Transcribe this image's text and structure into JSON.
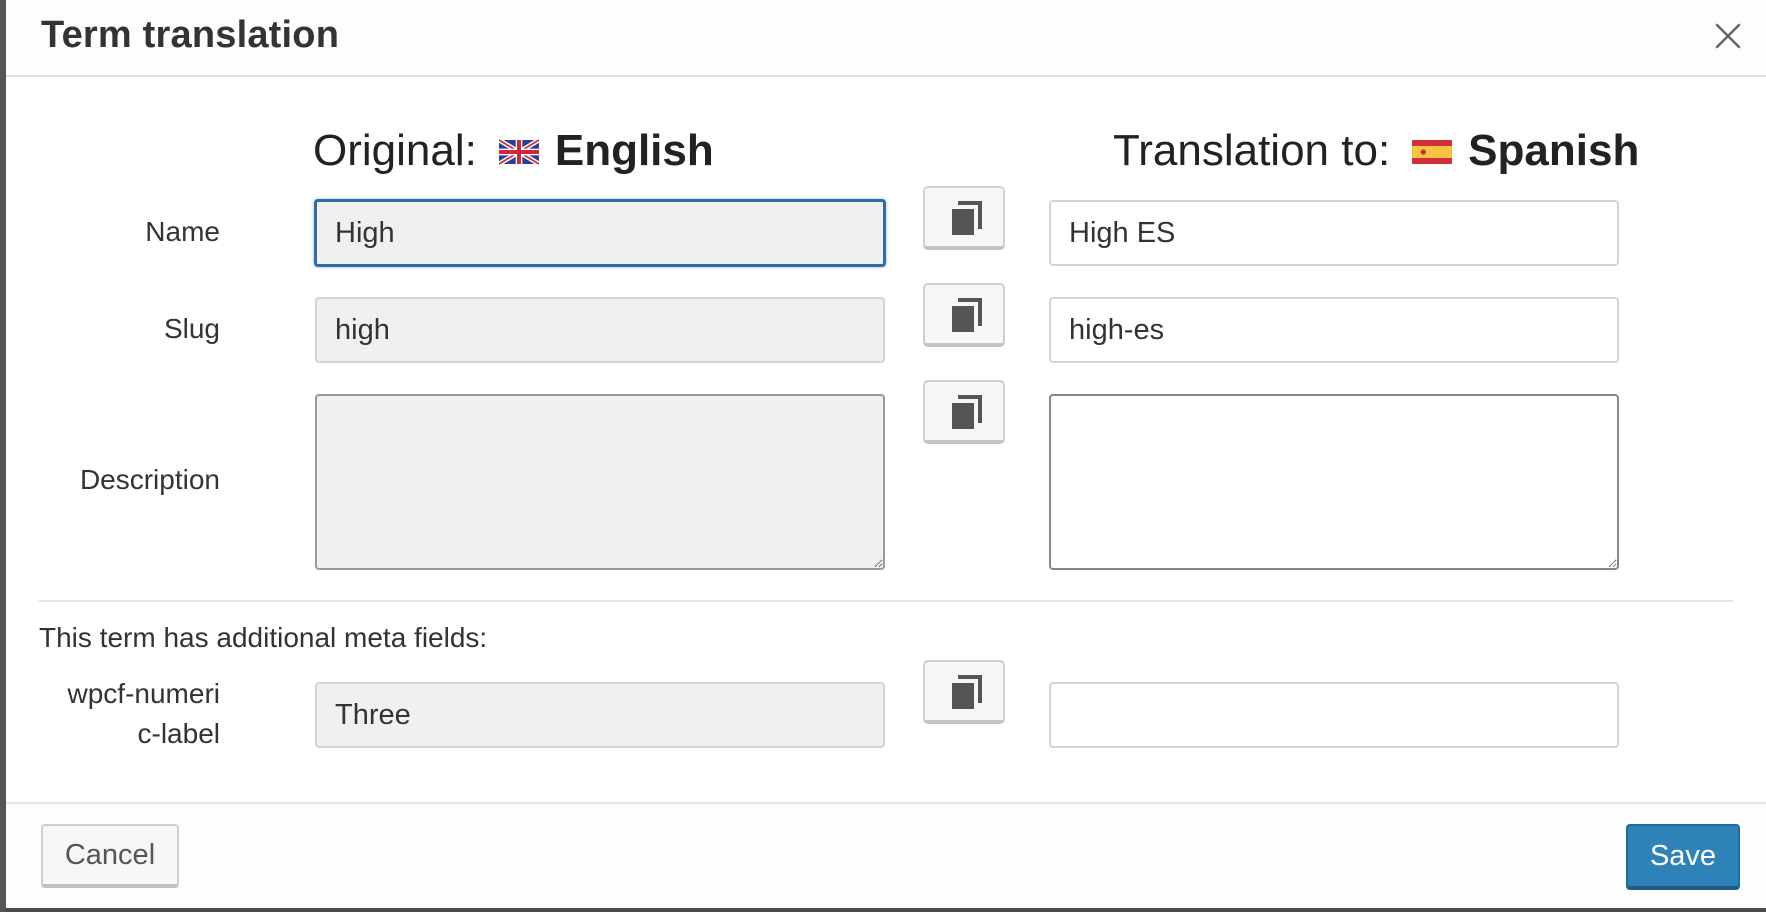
{
  "dialog": {
    "title": "Term translation",
    "close_icon": "close-icon"
  },
  "original": {
    "prefix": "Original:",
    "language": "English",
    "flag_icon": "uk-flag-icon"
  },
  "translation": {
    "prefix": "Translation to:",
    "language": "Spanish",
    "flag_icon": "spain-flag-icon"
  },
  "fields": {
    "name": {
      "label": "Name",
      "original": "High",
      "translated": "High ES"
    },
    "slug": {
      "label": "Slug",
      "original": "high",
      "translated": "high-es"
    },
    "description": {
      "label": "Description",
      "original": "",
      "translated": ""
    }
  },
  "meta": {
    "note": "This term has additional meta fields:",
    "field": {
      "label_line1": "wpcf-numeri",
      "label_line2": "c-label",
      "original": "Three",
      "translated": ""
    }
  },
  "footer": {
    "cancel_label": "Cancel",
    "save_label": "Save"
  },
  "colors": {
    "save_button": "#2d82b7",
    "focus_border": "#2f6da8",
    "readonly_bg": "#f0f0f0"
  }
}
